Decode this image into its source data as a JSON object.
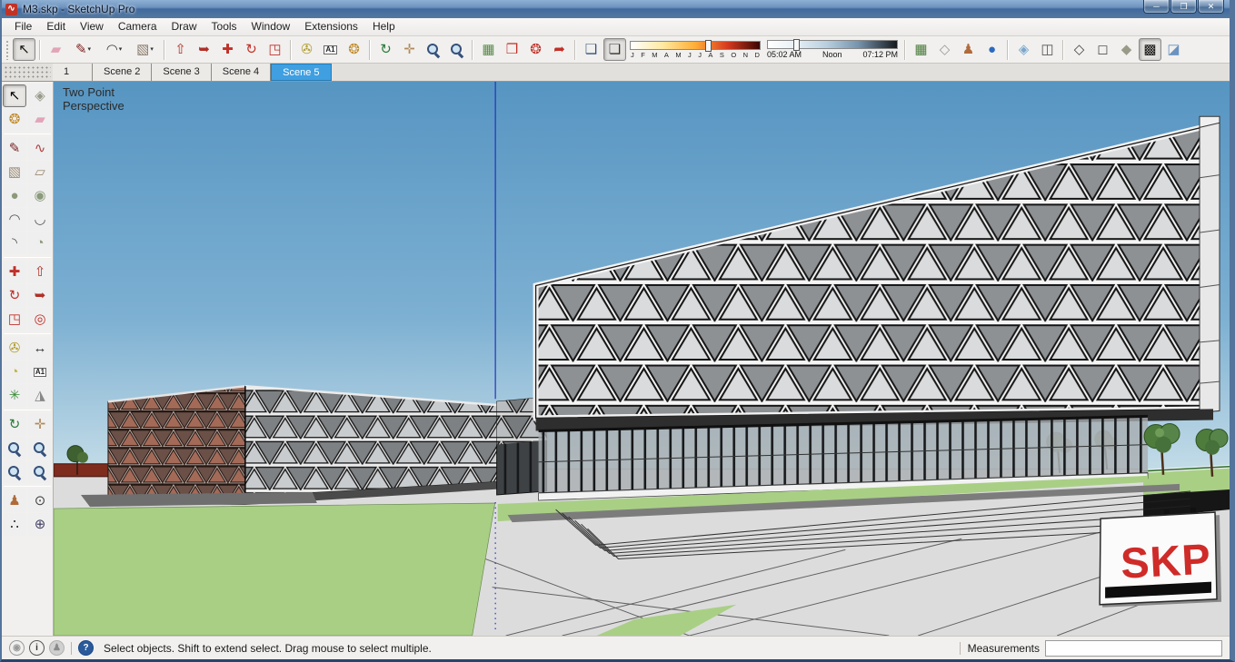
{
  "window": {
    "title": "M3.skp - SketchUp Pro",
    "logo": "∿",
    "controls": [
      {
        "name": "minimize-button",
        "glyph": "─"
      },
      {
        "name": "restore-button",
        "glyph": "❐"
      },
      {
        "name": "close-button",
        "glyph": "✕"
      }
    ]
  },
  "menu_bar": {
    "items": [
      "File",
      "Edit",
      "View",
      "Camera",
      "Draw",
      "Tools",
      "Window",
      "Extensions",
      "Help"
    ]
  },
  "top_toolbar": {
    "shadow_months": [
      "J",
      "F",
      "M",
      "A",
      "M",
      "J",
      "J",
      "A",
      "S",
      "O",
      "N",
      "D"
    ],
    "month_slider_pos_pct": 60,
    "time_slider_pos_pct": 22,
    "time_slider": {
      "start_label": "05:02 AM",
      "mid_label": "Noon",
      "end_label": "07:12 PM"
    },
    "groups": [
      {
        "items": [
          {
            "k": "tool",
            "n": "select-tool",
            "icon": "cursor-icon",
            "g": "↖",
            "c": "#111",
            "pressed": true
          }
        ]
      },
      {
        "items": [
          {
            "k": "tool",
            "n": "eraser-tool",
            "icon": "eraser-icon",
            "g": "▰",
            "c": "#e2a4b8"
          },
          {
            "k": "tool",
            "n": "line-tool",
            "icon": "pencil-icon",
            "g": "✎",
            "c": "#7a2222",
            "dd": true
          },
          {
            "k": "tool",
            "n": "arc-tool",
            "icon": "arc-icon",
            "g": "◠",
            "c": "#444",
            "dd": true
          },
          {
            "k": "tool",
            "n": "rectangle-tool",
            "icon": "rectangle-icon",
            "g": "▧",
            "c": "#8a7a6a",
            "dd": true
          }
        ]
      },
      {
        "items": [
          {
            "k": "tool",
            "n": "push-pull-tool",
            "icon": "push-pull-icon",
            "g": "⇧",
            "c": "#b03028"
          },
          {
            "k": "tool",
            "n": "follow-me-tool",
            "icon": "follow-me-icon",
            "g": "➥",
            "c": "#b03028"
          },
          {
            "k": "tool",
            "n": "move-tool",
            "icon": "move-icon",
            "g": "✚",
            "c": "#c03028"
          },
          {
            "k": "tool",
            "n": "rotate-tool",
            "icon": "rotate-icon",
            "g": "↻",
            "c": "#c03028"
          },
          {
            "k": "tool",
            "n": "scale-tool",
            "icon": "scale-icon",
            "g": "◳",
            "c": "#c03028"
          }
        ]
      },
      {
        "items": [
          {
            "k": "tool",
            "n": "tape-measure-tool",
            "icon": "tape-measure-icon",
            "g": "✇",
            "c": "#b0992a"
          },
          {
            "k": "a1",
            "n": "text-tool",
            "icon": "text-a1-icon",
            "g": "A1"
          },
          {
            "k": "tool",
            "n": "paint-bucket-tool",
            "icon": "paint-bucket-icon",
            "g": "❂",
            "c": "#c08a28"
          }
        ]
      },
      {
        "items": [
          {
            "k": "tool",
            "n": "orbit-tool",
            "icon": "orbit-icon",
            "g": "↻",
            "c": "#2a7a3a"
          },
          {
            "k": "tool",
            "n": "pan-tool",
            "icon": "pan-hand-icon",
            "g": "✛",
            "c": "#b08a5a"
          },
          {
            "k": "mag",
            "n": "zoom-tool",
            "icon": "magnifier-icon"
          },
          {
            "k": "mag",
            "n": "zoom-extents-tool",
            "icon": "magnifier-extents-icon"
          }
        ]
      },
      {
        "items": [
          {
            "k": "tool",
            "n": "photo-map-tool",
            "icon": "map-icon",
            "g": "▦",
            "c": "#5a8a4a"
          },
          {
            "k": "tool",
            "n": "warehouse-3d-tool",
            "icon": "warehouse-icon",
            "g": "❒",
            "c": "#c03028"
          },
          {
            "k": "tool",
            "n": "extension-warehouse-tool",
            "icon": "extension-badge-icon",
            "g": "❂",
            "c": "#c03028"
          },
          {
            "k": "tool",
            "n": "share-model-tool",
            "icon": "share-arrow-icon",
            "g": "➦",
            "c": "#c03028"
          }
        ]
      },
      {
        "items": [
          {
            "k": "tool",
            "n": "shadow-settings-button",
            "icon": "shadow-dialog-icon",
            "g": "❑",
            "c": "#35507a"
          },
          {
            "k": "tool",
            "n": "shadow-toggle-button",
            "icon": "shadow-box-icon",
            "g": "❏",
            "c": "#333",
            "pressed": true
          },
          {
            "k": "months",
            "n": "shadow-month-slider"
          },
          {
            "k": "time",
            "n": "shadow-time-slider"
          }
        ]
      },
      {
        "items": [
          {
            "k": "tool",
            "n": "add-location-button",
            "icon": "location-map-icon",
            "g": "▦",
            "c": "#4a7a3a"
          },
          {
            "k": "tool",
            "n": "toggle-terrain-button",
            "icon": "terrain-icon",
            "g": "◇",
            "c": "#999"
          },
          {
            "k": "tool",
            "n": "photo-textures-button",
            "icon": "person-icon",
            "g": "♟",
            "c": "#b06a3a"
          },
          {
            "k": "tool",
            "n": "google-earth-button",
            "icon": "globe-icon",
            "g": "●",
            "c": "#2a6ac0"
          }
        ]
      },
      {
        "items": [
          {
            "k": "tool",
            "n": "xray-style-button",
            "icon": "xray-box-icon",
            "g": "◈",
            "c": "#7aa7cc"
          },
          {
            "k": "tool",
            "n": "back-edges-style-button",
            "icon": "back-edges-box-icon",
            "g": "◫",
            "c": "#555"
          }
        ]
      },
      {
        "items": [
          {
            "k": "tool",
            "n": "wireframe-style-button",
            "icon": "wireframe-box-icon",
            "g": "◇",
            "c": "#444"
          },
          {
            "k": "tool",
            "n": "hidden-line-style-button",
            "icon": "hidden-line-box-icon",
            "g": "◻",
            "c": "#555"
          },
          {
            "k": "tool",
            "n": "shaded-style-button",
            "icon": "shaded-box-icon",
            "g": "◆",
            "c": "#9a9a8a"
          },
          {
            "k": "tool",
            "n": "shaded-textures-style-button",
            "icon": "textured-box-icon",
            "g": "▩",
            "c": "#111",
            "pressed": true
          },
          {
            "k": "tool",
            "n": "monochrome-style-button",
            "icon": "monochrome-box-icon",
            "g": "◪",
            "c": "#6a93c0"
          }
        ]
      }
    ]
  },
  "scene_tabs": {
    "tabs": [
      {
        "label": "1",
        "active": false
      },
      {
        "label": "Scene 2",
        "active": false
      },
      {
        "label": "Scene 3",
        "active": false
      },
      {
        "label": "Scene 4",
        "active": false
      },
      {
        "label": "Scene 5",
        "active": true
      }
    ],
    "active_color": "#3f9fe0"
  },
  "left_toolbar": {
    "items": [
      {
        "k": "tool",
        "n": "select-tool",
        "icon": "cursor-icon",
        "g": "↖",
        "c": "#000",
        "pressed": true
      },
      {
        "k": "tool",
        "n": "make-component-tool",
        "icon": "component-icon",
        "g": "◈",
        "c": "#9a9a8a"
      },
      {
        "k": "tool",
        "n": "paint-bucket-tool",
        "icon": "paint-bucket-icon",
        "g": "❂",
        "c": "#c08a28"
      },
      {
        "k": "tool",
        "n": "eraser-tool",
        "icon": "eraser-icon",
        "g": "▰",
        "c": "#e2a4b8"
      },
      {
        "k": "div"
      },
      {
        "k": "tool",
        "n": "line-tool",
        "icon": "pencil-icon",
        "g": "✎",
        "c": "#7a2222"
      },
      {
        "k": "tool",
        "n": "freehand-tool",
        "icon": "freehand-icon",
        "g": "∿",
        "c": "#b04040"
      },
      {
        "k": "tool",
        "n": "rectangle-tool",
        "icon": "rectangle-icon",
        "g": "▧",
        "c": "#9a8a72"
      },
      {
        "k": "tool",
        "n": "rotated-rectangle-tool",
        "icon": "rotated-rectangle-icon",
        "g": "▱",
        "c": "#9a8a72"
      },
      {
        "k": "tool",
        "n": "circle-tool",
        "icon": "circle-icon",
        "g": "●",
        "c": "#8a9a7a"
      },
      {
        "k": "tool",
        "n": "polygon-tool",
        "icon": "polygon-icon",
        "g": "◉",
        "c": "#8a9a7a"
      },
      {
        "k": "tool",
        "n": "arc-tool",
        "icon": "arc-icon",
        "g": "◠",
        "c": "#555"
      },
      {
        "k": "tool",
        "n": "two-point-arc-tool",
        "icon": "arc2-icon",
        "g": "◡",
        "c": "#555"
      },
      {
        "k": "tool",
        "n": "three-point-arc-tool",
        "icon": "arc3-icon",
        "g": "◝",
        "c": "#555"
      },
      {
        "k": "tool",
        "n": "pie-tool",
        "icon": "pie-icon",
        "g": "◔",
        "c": "#8a9a7a"
      },
      {
        "k": "div"
      },
      {
        "k": "tool",
        "n": "move-tool",
        "icon": "move-icon",
        "g": "✚",
        "c": "#c03028"
      },
      {
        "k": "tool",
        "n": "push-pull-tool",
        "icon": "push-pull-icon",
        "g": "⇧",
        "c": "#b03028"
      },
      {
        "k": "tool",
        "n": "rotate-tool",
        "icon": "rotate-icon",
        "g": "↻",
        "c": "#c03028"
      },
      {
        "k": "tool",
        "n": "follow-me-tool",
        "icon": "follow-me-icon",
        "g": "➥",
        "c": "#b03028"
      },
      {
        "k": "tool",
        "n": "scale-tool",
        "icon": "scale-icon",
        "g": "◳",
        "c": "#c03028"
      },
      {
        "k": "tool",
        "n": "offset-tool",
        "icon": "offset-icon",
        "g": "◎",
        "c": "#c03028"
      },
      {
        "k": "div"
      },
      {
        "k": "tool",
        "n": "tape-measure-tool",
        "icon": "tape-measure-icon",
        "g": "✇",
        "c": "#b0992a"
      },
      {
        "k": "tool",
        "n": "dimensions-tool",
        "icon": "dimension-icon",
        "g": "↔",
        "c": "#333"
      },
      {
        "k": "tool",
        "n": "protractor-tool",
        "icon": "protractor-icon",
        "g": "◔",
        "c": "#c8b040"
      },
      {
        "k": "a1",
        "n": "text-tool",
        "icon": "text-a1-icon",
        "g": "A1"
      },
      {
        "k": "tool",
        "n": "axes-tool",
        "icon": "axes-icon",
        "g": "✳",
        "c": "#3a8a3a"
      },
      {
        "k": "tool",
        "n": "three-d-text-tool",
        "icon": "3d-text-icon",
        "g": "◮",
        "c": "#888"
      },
      {
        "k": "div"
      },
      {
        "k": "tool",
        "n": "orbit-tool",
        "icon": "orbit-icon",
        "g": "↻",
        "c": "#2a7a3a"
      },
      {
        "k": "tool",
        "n": "pan-tool",
        "icon": "pan-hand-icon",
        "g": "✛",
        "c": "#b08a5a"
      },
      {
        "k": "mag",
        "n": "zoom-tool",
        "icon": "magnifier-icon"
      },
      {
        "k": "mag",
        "n": "zoom-window-tool",
        "icon": "magnifier-window-icon"
      },
      {
        "k": "mag",
        "n": "zoom-extents-tool",
        "icon": "magnifier-extents-icon"
      },
      {
        "k": "mag",
        "n": "zoom-previous-tool",
        "icon": "magnifier-previous-icon"
      },
      {
        "k": "div"
      },
      {
        "k": "tool",
        "n": "position-camera-tool",
        "icon": "camera-person-icon",
        "g": "♟",
        "c": "#b06a3a"
      },
      {
        "k": "tool",
        "n": "look-around-tool",
        "icon": "eye-icon",
        "g": "⊙",
        "c": "#444"
      },
      {
        "k": "tool",
        "n": "walk-tool",
        "icon": "footprints-icon",
        "g": "∴",
        "c": "#222"
      },
      {
        "k": "tool",
        "n": "section-plane-tool",
        "icon": "section-plane-icon",
        "g": "⊕",
        "c": "#446"
      }
    ]
  },
  "viewport": {
    "overlay_line1": "Two Point",
    "overlay_line2": "Perspective",
    "watermark": "SKP",
    "colors": {
      "sky_top": "#5795c2",
      "sky_horizon": "#c5dde8",
      "lawn": "#a9cf85",
      "plaza": "#dcdcdd",
      "axis_blue": "#2233bb",
      "watermark_red": "#cf2b28"
    }
  },
  "status_bar": {
    "icons": [
      {
        "name": "geolocation-icon",
        "g": "◉",
        "bg": "#f1f0ee",
        "fg": "#9a9a9a",
        "border": "#9a9a9a"
      },
      {
        "name": "credits-icon",
        "g": "i",
        "bg": "#f1f0ee",
        "fg": "#333",
        "border": "#555"
      },
      {
        "name": "signin-icon",
        "g": "♟",
        "bg": "#d0d0d0",
        "fg": "#8a8a8a",
        "border": "#b0b0b0"
      },
      {
        "name": "help-icon",
        "g": "?",
        "bg": "#2a5a9a",
        "fg": "#fff",
        "border": "#1a4a8a"
      }
    ],
    "hint": "Select objects. Shift to extend select. Drag mouse to select multiple.",
    "measurements_label": "Measurements",
    "measurements_value": ""
  }
}
